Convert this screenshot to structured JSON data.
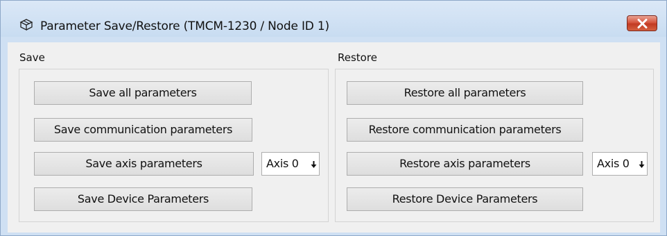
{
  "window": {
    "title": "Parameter Save/Restore (TMCM-1230 / Node ID 1)",
    "title_icon": "box-icon",
    "close_icon": "close-icon"
  },
  "save": {
    "label": "Save",
    "buttons": [
      "Save all parameters",
      "Save communication parameters",
      "Save axis parameters",
      "Save Device Parameters"
    ],
    "axis_select": "Axis 0"
  },
  "restore": {
    "label": "Restore",
    "buttons": [
      "Restore all parameters",
      "Restore communication parameters",
      "Restore axis parameters",
      "Restore Device Parameters"
    ],
    "axis_select": "Axis 0"
  },
  "colors": {
    "window_frame": "#cfe0f3",
    "client_bg": "#f0f0f0",
    "close_button": "#c8452d"
  }
}
